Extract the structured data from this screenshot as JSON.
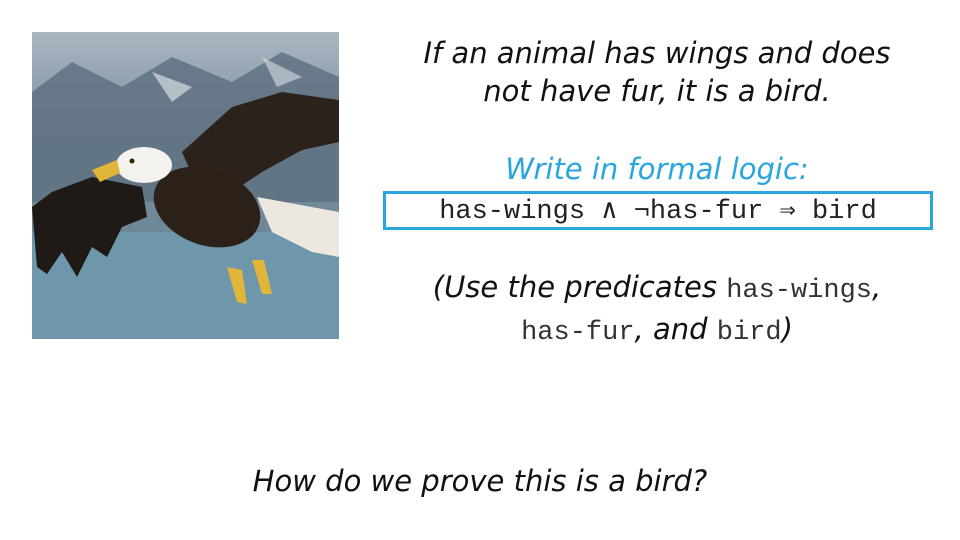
{
  "slide": {
    "statement": {
      "line1": "If an animal has wings and does",
      "line2": "not have fur, it is a bird."
    },
    "prompt": "Write in formal logic:",
    "formula": "has-wings ∧ ¬has-fur ⇒ bird",
    "note": {
      "open": "(Use the predicates",
      "pred1": "has-wings",
      "comma1": ",",
      "pred2": "has-fur",
      "middle": ", and",
      "pred3": "bird",
      "close": ")"
    },
    "question": "How do we prove this is a bird?"
  },
  "colors": {
    "accent": "#29a6dd",
    "text": "#111111"
  },
  "image": {
    "subject": "bald-eagle-in-flight"
  }
}
